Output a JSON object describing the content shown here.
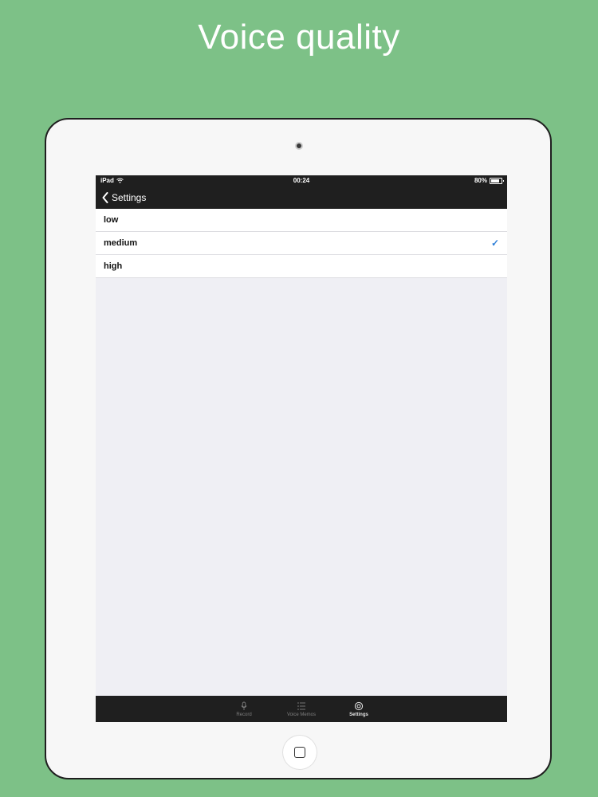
{
  "headline": "Voice quality",
  "status_bar": {
    "device": "iPad",
    "time": "00:24",
    "battery": "80%",
    "battery_level": 0.8
  },
  "nav": {
    "back_label": "Settings"
  },
  "options": [
    {
      "label": "low",
      "selected": false
    },
    {
      "label": "medium",
      "selected": true
    },
    {
      "label": "high",
      "selected": false
    }
  ],
  "selected_mark": "✓",
  "tabs": [
    {
      "label": "Record",
      "icon": "microphone-icon",
      "active": false
    },
    {
      "label": "Voice Memos",
      "icon": "list-icon",
      "active": false
    },
    {
      "label": "Settings",
      "icon": "gear-icon",
      "active": true
    }
  ],
  "colors": {
    "background": "#7dc187",
    "bar": "#1f1f1f",
    "checkmark": "#2f7fd8"
  }
}
